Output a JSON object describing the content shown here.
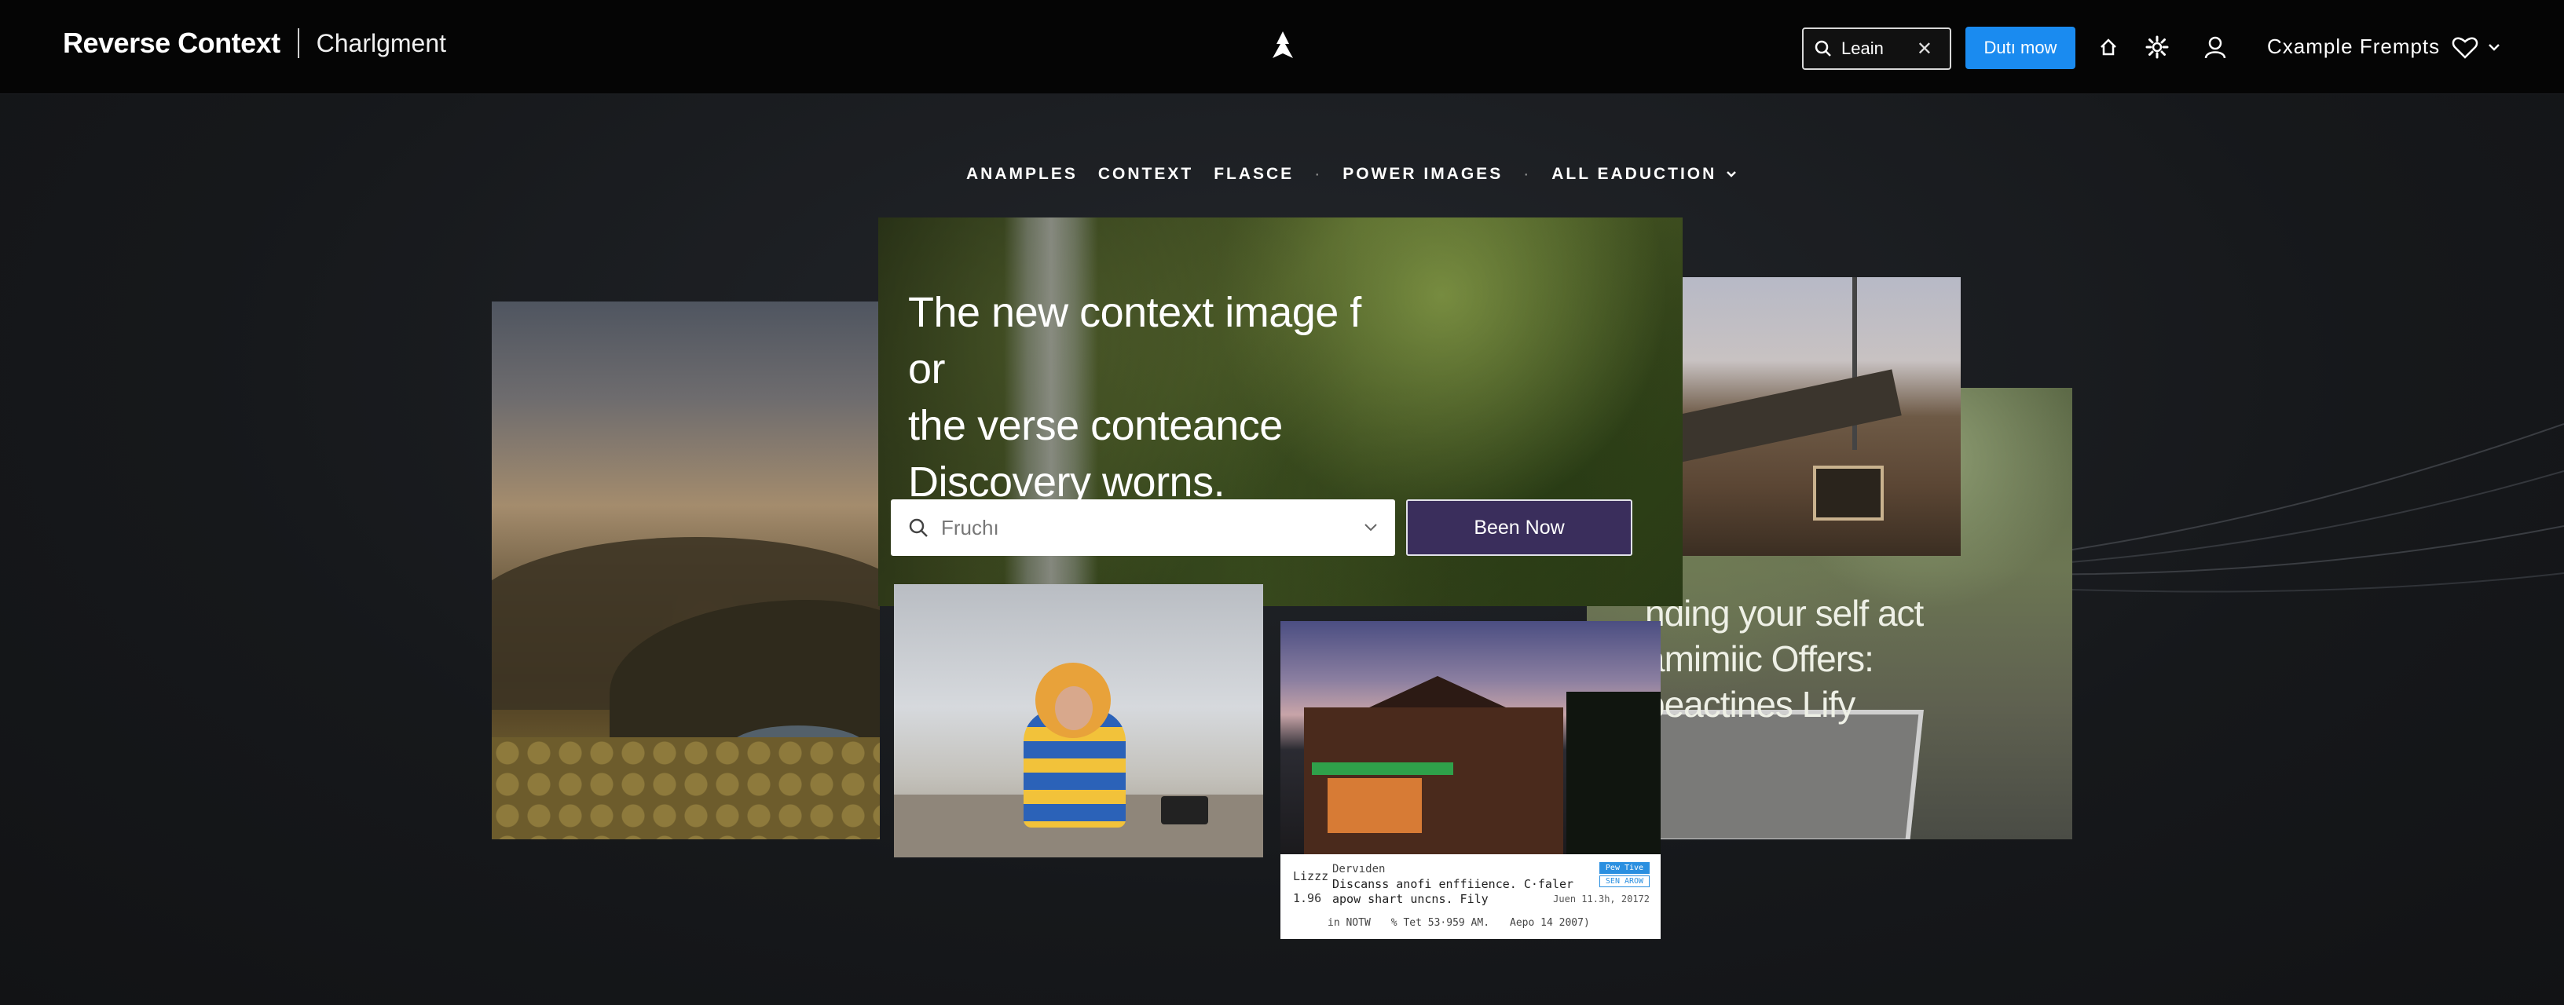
{
  "header": {
    "brand": "Reverse Context",
    "sub_brand": "Charlgment",
    "search_value": "Leain",
    "cta_label": "Dutı mow",
    "user_name": "Cxample Frempts"
  },
  "nav": {
    "items": [
      "ANAMPLES",
      "CONTEXT",
      "FLASCE",
      "POWER IMAGES",
      "ALL EADUCTION"
    ],
    "separator": "·"
  },
  "hero": {
    "title_lines": [
      "The new context image f or",
      "the verse conteance",
      "Discovery worns."
    ],
    "search_value": "Fruchı",
    "button_label": "Been Now"
  },
  "ivy_overlay": {
    "lines": [
      "nding your self act",
      "amimiic Offers:",
      "beactines Lify"
    ]
  },
  "info_card": {
    "left_top": "Lizzz",
    "left_bottom": "1.96",
    "author": "Dervıden",
    "headline": "Discanss anofi enffiience. C·faler",
    "subline": "apow shart uncns. Fily",
    "tag_top": "Pew Tive",
    "tag_bottom": "SEN AROW",
    "date": "Juen 11.3h, 20172",
    "foot_1": "in NOTW",
    "foot_2": "% Tet 53·959 AM.",
    "foot_3": "Aepo 14 2007)"
  },
  "colors": {
    "background": "#17191c",
    "topbar": "#050505",
    "cta_blue": "#1a8bf0",
    "hero_button": "#3a2e5c"
  },
  "icons": [
    "search-icon",
    "close-icon",
    "logo-mark-icon",
    "home-icon",
    "settings-icon",
    "user-icon",
    "heart-icon",
    "chevron-down-icon"
  ]
}
